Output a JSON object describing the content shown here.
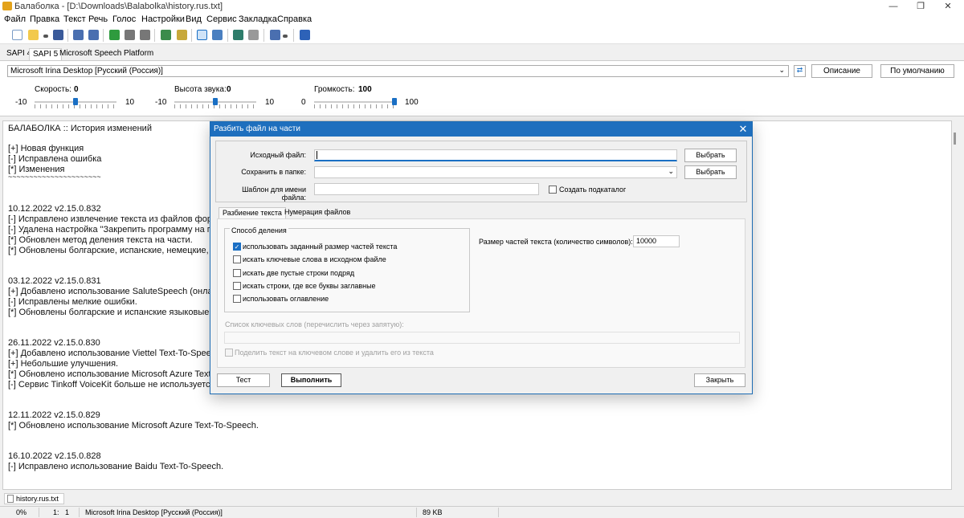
{
  "window": {
    "title": "Балаболка - [D:\\Downloads\\Balabolka\\history.rus.txt]",
    "controls": [
      "—",
      "❐",
      "✕"
    ]
  },
  "menu": [
    "Файл",
    "Правка",
    "Текст",
    "Речь",
    "Голос",
    "Настройки",
    "Вид",
    "Сервис",
    "Закладка",
    "Справка"
  ],
  "sapi_tabs": [
    "SAPI 4",
    "SAPI 5",
    "Microsoft Speech Platform"
  ],
  "voice": {
    "selected": "Microsoft Irina Desktop [Русский (Россия)]",
    "description_button": "Описание",
    "default_button": "По умолчанию",
    "rate": {
      "label": "Скорость:",
      "value": "0",
      "min": "-10",
      "max": "10",
      "level": 0.5
    },
    "pitch": {
      "label": "Высота звука:",
      "value": "0",
      "min": "-10",
      "max": "10",
      "level": 0.5
    },
    "volume": {
      "label": "Громкость:",
      "value": "100",
      "min": "0",
      "max": "100",
      "level": 1.0
    }
  },
  "editor": {
    "lines": [
      "БАЛАБОЛКА :: История изменений",
      "[+] Новая функция",
      "[-] Исправлена ошибка",
      "[*] Изменения",
      "~~~~~~~~~~~~~~~~~~~~~~",
      "10.12.2022    v2.15.0.832",
      "[-] Исправлено извлечение текста из файлов форм",
      "[-] Удалена настройка \"Закрепить программу на па",
      "[*] Обновлен метод деления текста на части.",
      "[*] Обновлены болгарские, испанские, немецкие, сл",
      "03.12.2022    v2.15.0.831",
      "[+] Добавлено использование SaluteSpeech (онлайн",
      "[-] Исправлены мелкие ошибки.",
      "[*] Обновлены болгарские и испанские языковые ре",
      "26.11.2022    v2.15.0.830",
      "[+] Добавлено использование Viettel Text-To-Speech",
      "[+] Небольшие улучшения.",
      "[*] Обновлено использование Microsoft Azure Text-T",
      "[-] Сервис Tinkoff VoiceKit больше не используется. П",
      "12.11.2022    v2.15.0.829",
      "[*] Обновлено использование Microsoft Azure Text-To-Speech.",
      "16.10.2022    v2.15.0.828",
      "[-] Исправлено использование Baidu Text-To-Speech."
    ]
  },
  "file_tab": "history.rus.txt",
  "status": {
    "progress": "0%",
    "position": "1:   1",
    "voice": "Microsoft Irina Desktop [Русский (Россия)]",
    "size": "89 KB"
  },
  "dialog": {
    "title": "Разбить файл на части",
    "source_label": "Исходный файл:",
    "source_value": "",
    "folder_label": "Сохранить в папке:",
    "folder_value": "",
    "template_label": "Шаблон для имени файла:",
    "template_value": "",
    "browse1": "Выбрать",
    "browse2": "Выбрать",
    "create_subdir": "Создать подкаталог",
    "tabs": [
      "Разбиение текста",
      "Нумерация файлов"
    ],
    "method_group": "Способ деления",
    "methods": [
      {
        "label": "использовать заданный размер частей текста",
        "checked": true
      },
      {
        "label": "искать ключевые слова в исходном файле",
        "checked": false
      },
      {
        "label": "искать две пустые строки подряд",
        "checked": false
      },
      {
        "label": "искать строки, где все буквы заглавные",
        "checked": false
      },
      {
        "label": "использовать оглавление",
        "checked": false
      }
    ],
    "size_label": "Размер частей текста (количество символов):",
    "size_value": "10000",
    "keywords_label": "Список ключевых слов (перечислить через запятую):",
    "split_on_keyword": "Поделить текст на ключевом слове и удалить его из текста",
    "test_button": "Тест",
    "run_button": "Выполнить",
    "close_button": "Закрыть"
  },
  "colors": {
    "accent": "#1e6fbe",
    "dialog_title": "#1e6fbe"
  }
}
